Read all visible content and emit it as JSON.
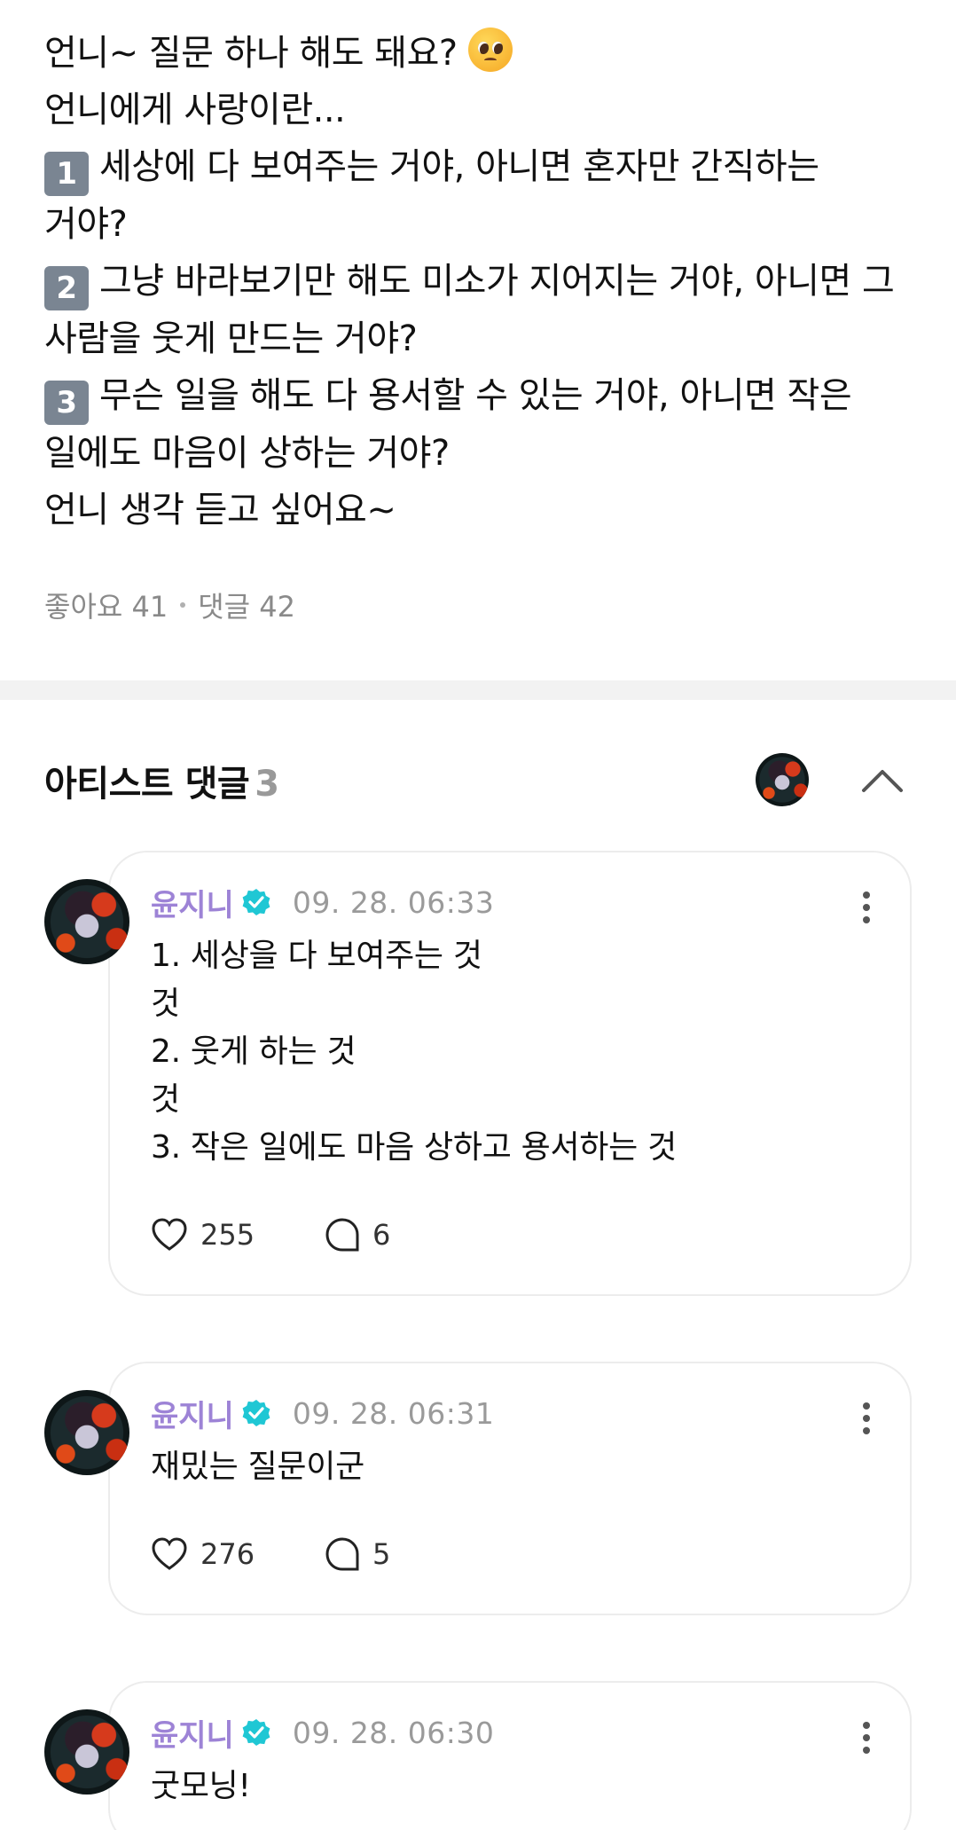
{
  "post": {
    "line1": "언니~ 질문 하나 해도 돼요?",
    "line2": "언니에게 사랑이란...",
    "q1_badge": "1",
    "q1_line1": "세상에 다 보여주는 거야, 아니면 혼자만 간직하는",
    "q1_line2": "거야?",
    "q2_badge": "2",
    "q2_line1": "그냥 바라보기만 해도 미소가 지어지는 거야, 아니면 그",
    "q2_line2": "사람을 웃게 만드는 거야?",
    "q3_badge": "3",
    "q3_line1": "무슨 일을 해도 다 용서할 수 있는 거야, 아니면 작은",
    "q3_line2": "일에도 마음이 상하는 거야?",
    "closing": "언니 생각 듣고 싶어요~",
    "likes": "좋아요 41",
    "comments": "댓글 42",
    "emoji_icon": "pleading-face-icon"
  },
  "artist_section": {
    "title": "아티스트 댓글",
    "count": "3"
  },
  "comments": [
    {
      "author": "윤지니",
      "time": "09. 28. 06:33",
      "text": "1. 세상을 다 보여주는 것\n것\n2. 웃게 하는 것\n것\n3. 작은 일에도 마음 상하고 용서하는 것",
      "likes": "255",
      "replies": "6"
    },
    {
      "author": "윤지니",
      "time": "09. 28. 06:31",
      "text": "재밌는 질문이군",
      "likes": "276",
      "replies": "5"
    },
    {
      "author": "윤지니",
      "time": "09. 28. 06:30",
      "text": "굿모닝!",
      "likes": "",
      "replies": ""
    }
  ],
  "colors": {
    "author_name": "#9d83d6",
    "verified_badge": "#1fc7d4",
    "muted_text": "#9a9a9a",
    "badge_bg": "#7a8592"
  }
}
